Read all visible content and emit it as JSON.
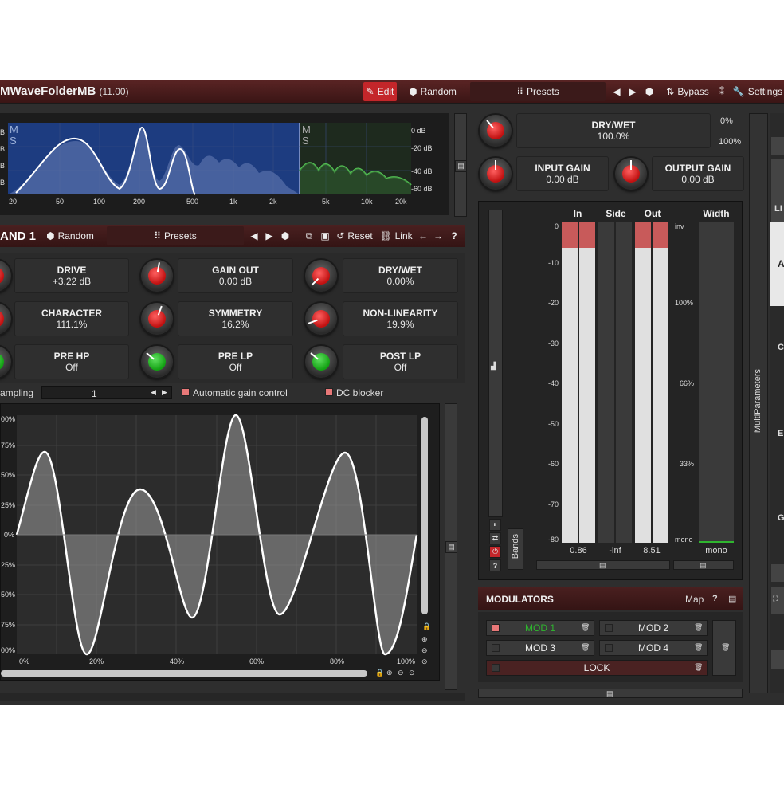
{
  "header": {
    "title": "MWaveFolderMB",
    "version": "(11.00)",
    "edit": "Edit",
    "random": "Random",
    "presets": "Presets",
    "bypass": "Bypass",
    "settings": "Settings"
  },
  "spectrum": {
    "left_ms": [
      "M",
      "S"
    ],
    "right_ms": [
      "M",
      "S"
    ],
    "db_labels": [
      "0 dB",
      "-20 dB",
      "-40 dB",
      "-60 dB"
    ],
    "freq_labels": [
      "20",
      "50",
      "100",
      "200",
      "500",
      "1k",
      "2k",
      "5k",
      "10k",
      "20k"
    ],
    "left_edge_labels": [
      "B",
      "B",
      "B",
      "B"
    ]
  },
  "band": {
    "name": "AND 1",
    "random": "Random",
    "presets": "Presets",
    "reset": "Reset",
    "link": "Link"
  },
  "params": [
    {
      "label": "DRIVE",
      "value": "+3.22 dB"
    },
    {
      "label": "GAIN OUT",
      "value": "0.00 dB"
    },
    {
      "label": "DRY/WET",
      "value": "0.00%"
    },
    {
      "label": "CHARACTER",
      "value": "111.1%"
    },
    {
      "label": "SYMMETRY",
      "value": "16.2%"
    },
    {
      "label": "NON-LINEARITY",
      "value": "19.9%"
    },
    {
      "label": "PRE HP",
      "value": "Off"
    },
    {
      "label": "PRE LP",
      "value": "Off"
    },
    {
      "label": "POST LP",
      "value": "Off"
    }
  ],
  "options": {
    "oversampling_label": "ampling",
    "oversampling_value": "1",
    "agc": "Automatic gain control",
    "dc": "DC blocker"
  },
  "waveform": {
    "y_labels": [
      "00%",
      "75%",
      "50%",
      "25%",
      "0%",
      "25%",
      "50%",
      "75%",
      "00%"
    ],
    "x_labels": [
      "0%",
      "20%",
      "40%",
      "60%",
      "80%",
      "100%"
    ]
  },
  "global": {
    "drywet_label": "DRY/WET",
    "drywet_value": "100.0%",
    "drywet_range": [
      "0%",
      "100%"
    ],
    "input_gain_label": "INPUT GAIN",
    "input_gain_value": "0.00 dB",
    "output_gain_label": "OUTPUT GAIN",
    "output_gain_value": "0.00 dB"
  },
  "meters": {
    "headers": [
      "In",
      "Side",
      "Out",
      "Width"
    ],
    "db_scale": [
      "0",
      "-10",
      "-20",
      "-30",
      "-40",
      "-50",
      "-60",
      "-70",
      "-80"
    ],
    "width_scale": [
      "inv",
      "100%",
      "66%",
      "33%",
      "mono"
    ],
    "readouts": {
      "in": "0.86",
      "side": "-inf",
      "out": "8.51",
      "width": "mono"
    },
    "in_peak_fraction": 0.08,
    "out_peak_fraction": 0.08,
    "bands_label": "Bands"
  },
  "side": {
    "multiparams": "MultiParameters",
    "letters": [
      "LI",
      "A",
      "C",
      "E",
      "G"
    ]
  },
  "modulators": {
    "title": "MODULATORS",
    "map": "Map",
    "items": [
      "MOD 1",
      "MOD 2",
      "MOD 3",
      "MOD 4"
    ],
    "lock": "LOCK"
  },
  "colors": {
    "accent_red": "#c4262a",
    "spectrum_blue": "#1a3a7a",
    "active_green": "#2fb52f"
  }
}
